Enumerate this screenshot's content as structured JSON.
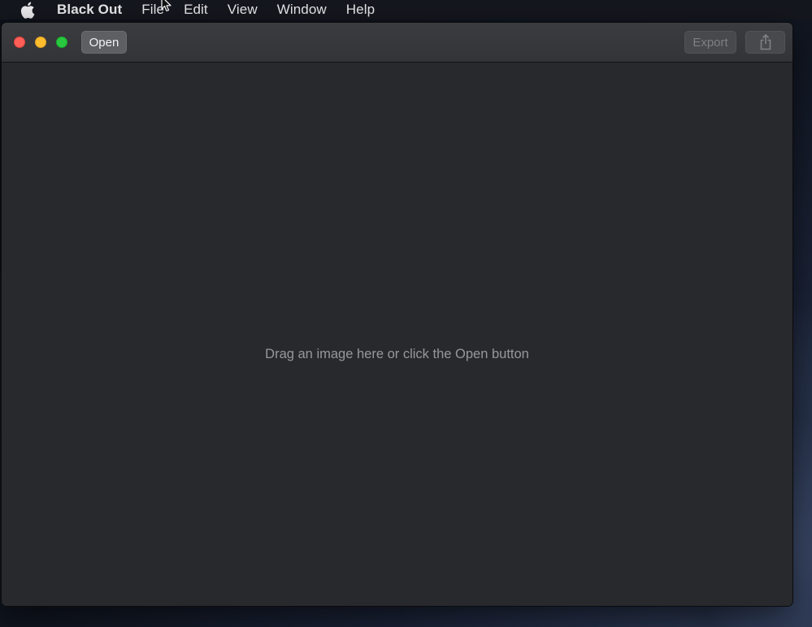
{
  "menubar": {
    "apple_icon": "apple-logo",
    "app_name": "Black Out",
    "items": [
      "File",
      "Edit",
      "View",
      "Window",
      "Help"
    ]
  },
  "window": {
    "toolbar": {
      "open_label": "Open",
      "export_label": "Export",
      "share_icon": "share-icon"
    },
    "content": {
      "placeholder": "Drag an image here or click the Open button"
    }
  }
}
